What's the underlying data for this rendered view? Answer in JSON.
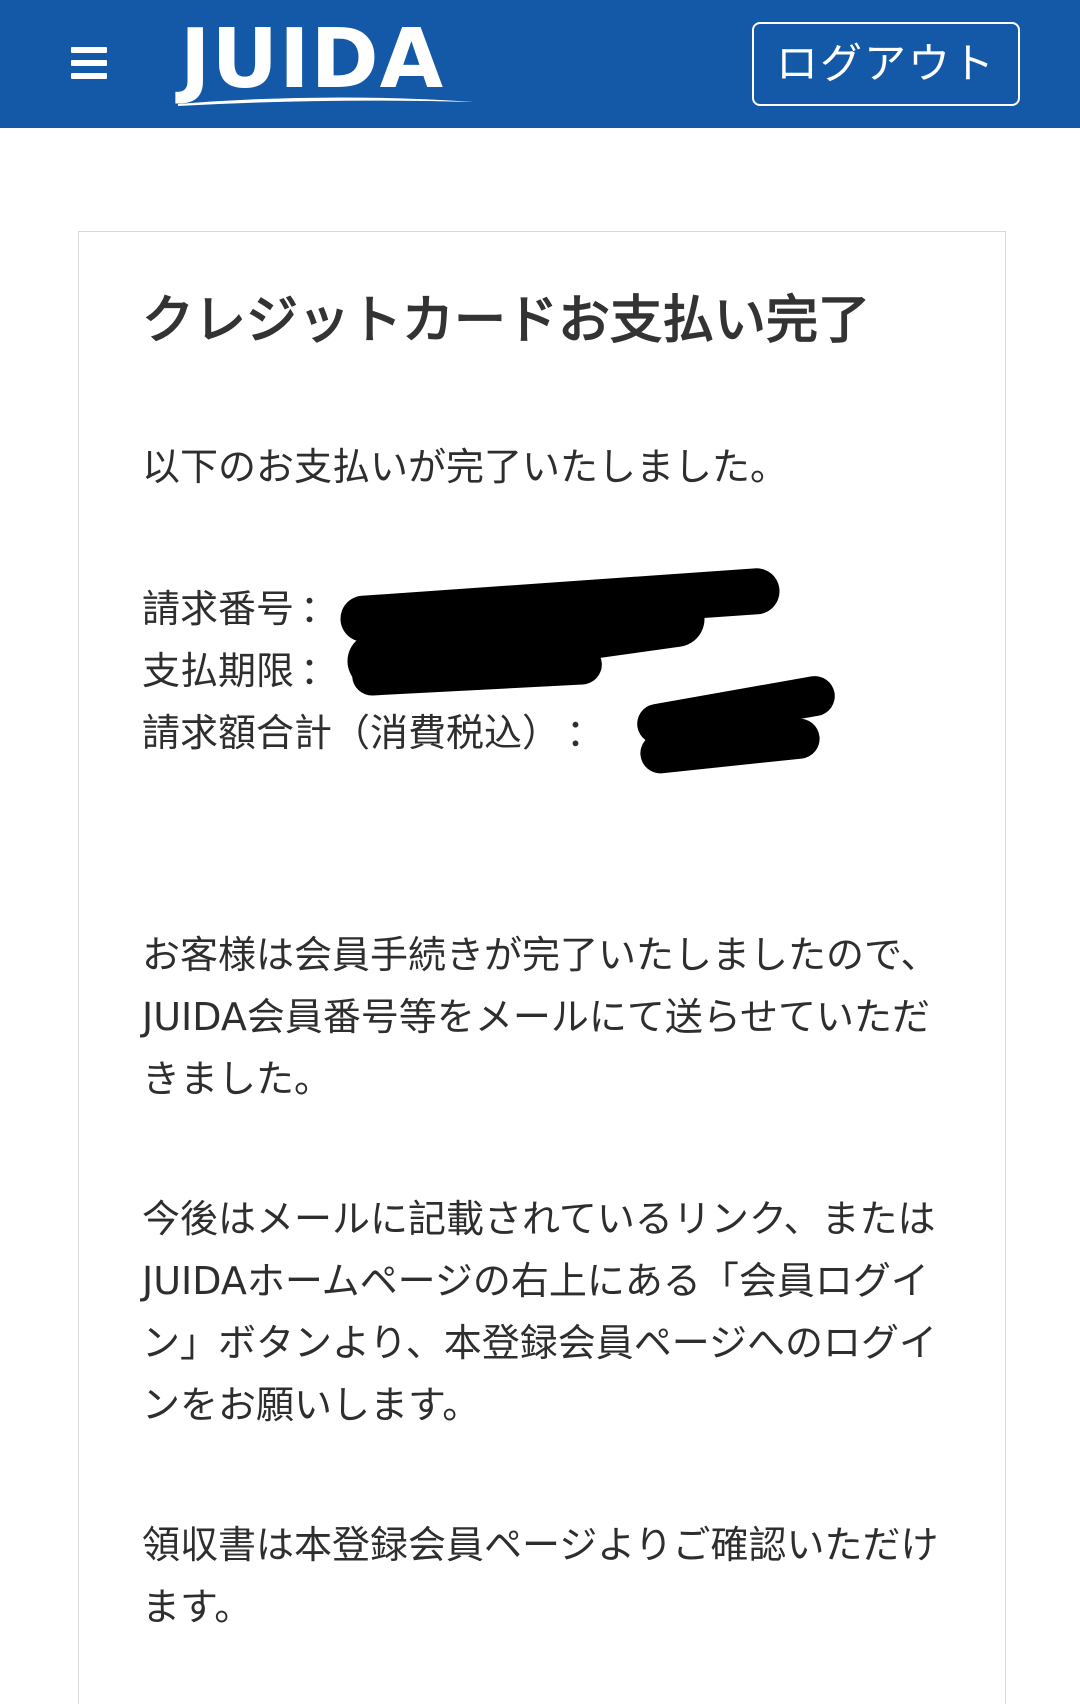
{
  "header": {
    "menu_icon": "hamburger-menu-icon",
    "logo_text": "JUIDA",
    "logout_label": "ログアウト",
    "background_color": "#1359a7"
  },
  "card": {
    "title": "クレジットカードお支払い完了",
    "intro": "以下のお支払いが完了いたしました。",
    "info": [
      {
        "label": "請求番号",
        "separator": "："
      },
      {
        "label": "支払期限",
        "separator": "："
      },
      {
        "label": "請求額合計（消費税込）",
        "separator": "："
      }
    ],
    "paragraph_member": "お客様は会員手続きが完了いたしましたので、JUIDA会員番号等をメールにて送らせていただきました。",
    "paragraph_login": "今後はメールに記載されているリンク、またはJUIDAホームページの右上にある「会員ログイン」ボタンより、本登録会員ページへのログインをお願いします。",
    "paragraph_receipt": "領収書は本登録会員ページよりご確認いただけます。"
  }
}
